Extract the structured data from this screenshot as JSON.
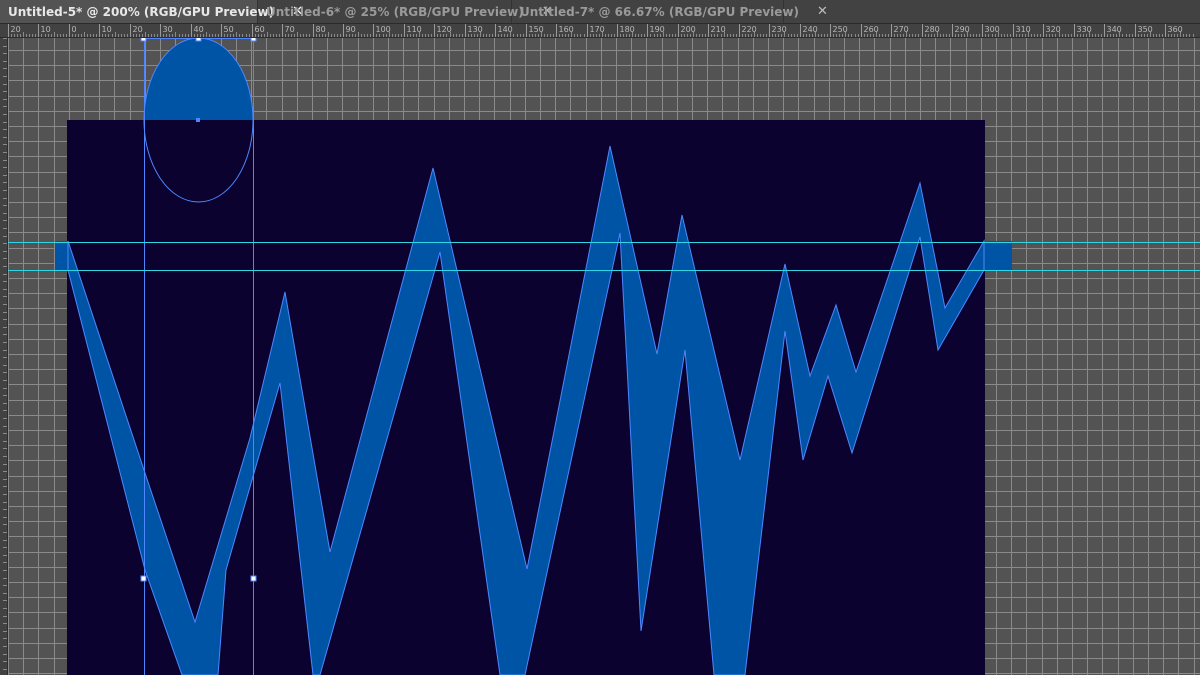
{
  "tabs": [
    {
      "label": "Untitled-5* @ 200% (RGB/GPU Preview)",
      "active": true
    },
    {
      "label": "Untitled-6* @ 25% (RGB/GPU Preview)",
      "active": false
    },
    {
      "label": "Untitled-7* @ 66.67% (RGB/GPU Preview)",
      "active": false
    }
  ],
  "close_glyph": "✕",
  "ruler": {
    "top_labels": [
      "20",
      "10",
      "0",
      "10",
      "20",
      "30",
      "40",
      "50",
      "60",
      "70",
      "80",
      "90",
      "100",
      "110",
      "120",
      "130",
      "140",
      "150",
      "160",
      "170",
      "180",
      "190",
      "200",
      "210",
      "220",
      "230",
      "240",
      "250",
      "260",
      "270",
      "280",
      "290",
      "300",
      "310",
      "320",
      "330",
      "340",
      "350",
      "360"
    ]
  },
  "colors": {
    "workspace_bg": "#535353",
    "grid_line": "#8a8a8a",
    "artboard": "#0b0230",
    "shape_fill": "#0054a6",
    "selection": "#4f86ff",
    "guide": "#2ed6e6"
  }
}
